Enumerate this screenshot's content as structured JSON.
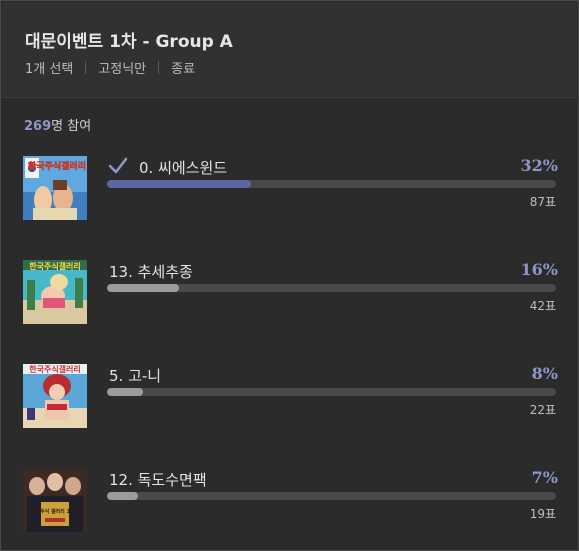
{
  "header": {
    "title": "대문이벤트 1차 - Group A",
    "meta": [
      "1개 선택",
      "고정닉만",
      "종료"
    ]
  },
  "participants": {
    "count": "269",
    "suffix": "명 참여"
  },
  "options": [
    {
      "label": "0. 씨에스윈드",
      "percent": "32%",
      "votes": "87표",
      "fraction": 0.32,
      "selected": true,
      "thumb_text": "한국주식갤러리"
    },
    {
      "label": "13. 추세추종",
      "percent": "16%",
      "votes": "42표",
      "fraction": 0.16,
      "selected": false,
      "thumb_text": "한국주식갤러리"
    },
    {
      "label": "5. 고-니",
      "percent": "8%",
      "votes": "22표",
      "fraction": 0.08,
      "selected": false,
      "thumb_text": "한국주식갤러리"
    },
    {
      "label": "12. 독도수면팩",
      "percent": "7%",
      "votes": "19표",
      "fraction": 0.07,
      "selected": false,
      "thumb_text": "한국주식 갤러리 1주년"
    }
  ],
  "colors": {
    "accent": "#8d96c7",
    "selected_bar": "#5e67a6",
    "bar": "#9c9c9c",
    "track": "#4a4a4a"
  },
  "icons": {
    "check": "check-icon"
  }
}
